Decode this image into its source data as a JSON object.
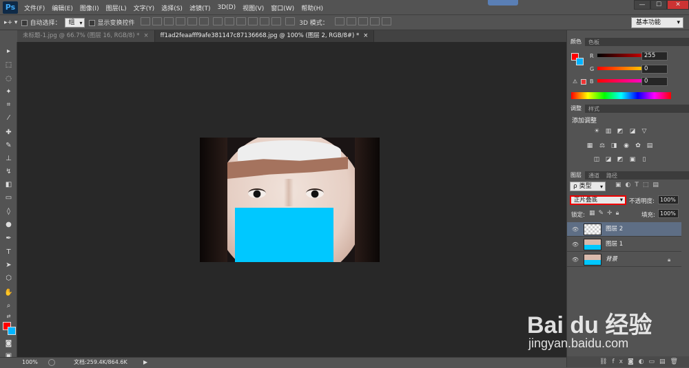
{
  "menubar": {
    "logo": "Ps",
    "items": [
      "文件(F)",
      "编辑(E)",
      "图像(I)",
      "图层(L)",
      "文字(Y)",
      "选择(S)",
      "滤镜(T)",
      "3D(D)",
      "视图(V)",
      "窗口(W)",
      "帮助(H)"
    ],
    "win_min": "—",
    "win_max": "☐",
    "win_close": "✕"
  },
  "options": {
    "auto_select_label": "自动选择：",
    "auto_select_value": "组",
    "show_transform_label": "显示变换控件",
    "mode_3d_label": "3D 模式：",
    "workspace": "基本功能"
  },
  "tabs": [
    {
      "label": "未标题-1.jpg @ 66.7% (图层 16, RGB/8) *",
      "close": "×"
    },
    {
      "label": "ff1ad2feaafff9afe381147c87136668.jpg @ 100% (图层 2, RGB/8#) *",
      "close": "×"
    }
  ],
  "color_panel": {
    "tabs": [
      "颜色",
      "色板"
    ],
    "r_label": "R",
    "r_value": "255",
    "g_label": "G",
    "g_value": "0",
    "b_label": "B",
    "b_value": "0",
    "fg_color": "#ff0000",
    "bg_color": "#00b4ff"
  },
  "adjust_panel": {
    "tabs": [
      "调整",
      "样式"
    ],
    "heading": "添加调整"
  },
  "layers_panel": {
    "tabs": [
      "图层",
      "通道",
      "路径"
    ],
    "filter_label": "ρ 类型",
    "blend_mode": "正片叠底",
    "opacity_label": "不透明度:",
    "opacity_value": "100%",
    "lock_label": "锁定:",
    "fill_label": "填充:",
    "fill_value": "100%",
    "layers": [
      {
        "name": "图层 2"
      },
      {
        "name": "图层 1"
      },
      {
        "name": "背景"
      }
    ]
  },
  "status": {
    "zoom": "100%",
    "doc_info": "文档:259.4K/864.6K"
  },
  "watermark": {
    "brand": "Bai du 经验",
    "url": "jingyan.baidu.com"
  }
}
